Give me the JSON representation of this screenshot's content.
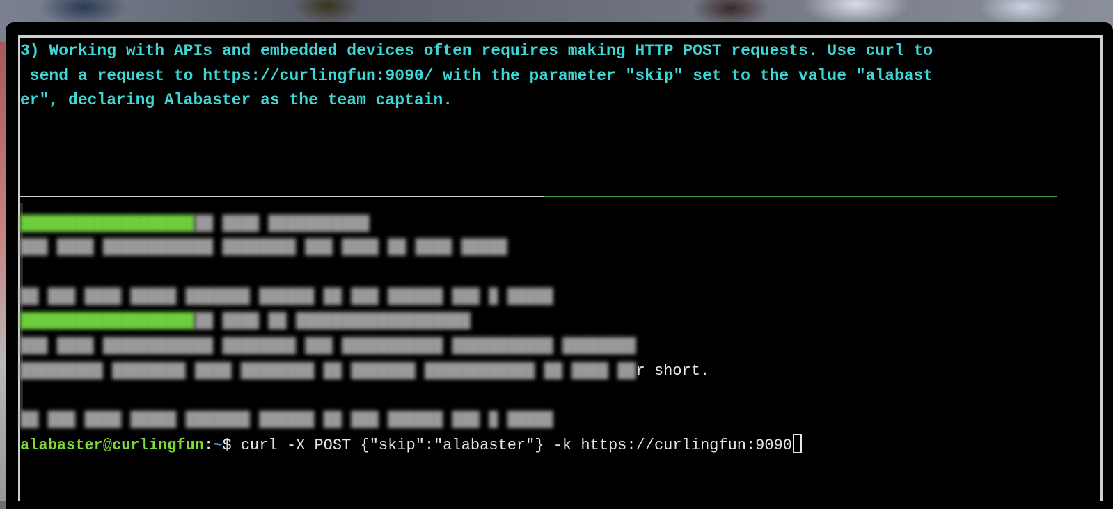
{
  "challenge": {
    "lines": [
      "3) Working with APIs and embedded devices often requires making HTTP POST requests. Use curl to",
      " send a request to https://curlingfun:9090/ with the parameter \"skip\" set to the value \"alabast",
      "er\", declaring Alabaster as the team captain."
    ]
  },
  "history": {
    "partial_visible_text": "r short."
  },
  "prompt": {
    "user_host": "alabaster@curlingfun",
    "separator": ":",
    "path": "~",
    "symbol": "$ ",
    "command": "curl -X POST {\"skip\":\"alabaster\"} -k https://curlingfun:9090"
  },
  "colors": {
    "challenge_text": "#3fd6d6",
    "prompt_user": "#7fd83a",
    "prompt_path": "#5da0ff",
    "divider_left": "#cfcfcf",
    "divider_right": "#3fa33f"
  }
}
